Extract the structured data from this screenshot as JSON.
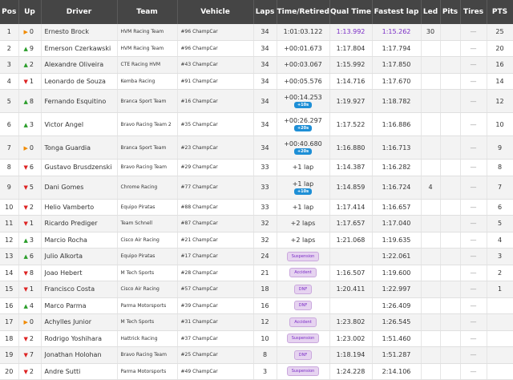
{
  "headers": {
    "pos": "Pos",
    "up": "Up",
    "driver": "Driver",
    "team": "Team",
    "vehicle": "Vehicle",
    "laps": "Laps",
    "time": "Time/Retired",
    "qual": "Qual Time",
    "fastest": "Fastest lap",
    "led": "Led",
    "pits": "Pits",
    "tires": "Tires",
    "pts": "PTS"
  },
  "colors": {
    "up": "#2a9d2a",
    "down": "#d22",
    "same": "#f08a00",
    "fastest": "#7a2cc6",
    "header_bg": "#454545"
  },
  "rows": [
    {
      "pos": "1",
      "dir": "same",
      "ch": "0",
      "driver": "Ernesto Brock",
      "team": "HVM Racing Team",
      "vehicle": "#96 ChampCar",
      "laps": "34",
      "time": "1:01:03.122",
      "pen": "",
      "qual": "1:13.992",
      "qual_best": true,
      "fastest": "1:15.262",
      "fastest_best": true,
      "led": "30",
      "pits": "",
      "tires": "—",
      "pts": "25"
    },
    {
      "pos": "2",
      "dir": "up",
      "ch": "9",
      "driver": "Emerson Czerkawski",
      "team": "HVM Racing Team",
      "vehicle": "#96 ChampCar",
      "laps": "34",
      "time": "+00:01.673",
      "pen": "",
      "qual": "1:17.804",
      "fastest": "1:17.794",
      "led": "",
      "pits": "",
      "tires": "—",
      "pts": "20"
    },
    {
      "pos": "3",
      "dir": "up",
      "ch": "2",
      "driver": "Alexandre Oliveira",
      "team": "CTE Racing HVM",
      "vehicle": "#43 ChampCar",
      "laps": "34",
      "time": "+00:03.067",
      "pen": "",
      "qual": "1:15.992",
      "fastest": "1:17.850",
      "led": "",
      "pits": "",
      "tires": "—",
      "pts": "16"
    },
    {
      "pos": "4",
      "dir": "down",
      "ch": "1",
      "driver": "Leonardo de Souza",
      "team": "Kemba Racing",
      "vehicle": "#91 ChampCar",
      "laps": "34",
      "time": "+00:05.576",
      "pen": "",
      "qual": "1:14.716",
      "fastest": "1:17.670",
      "led": "",
      "pits": "",
      "tires": "—",
      "pts": "14"
    },
    {
      "pos": "5",
      "dir": "up",
      "ch": "8",
      "driver": "Fernando Esquitino",
      "team": "Branca Sport Team",
      "vehicle": "#16 ChampCar",
      "laps": "34",
      "time": "+00:14.253",
      "pen": "+10s",
      "qual": "1:19.927",
      "fastest": "1:18.782",
      "led": "",
      "pits": "",
      "tires": "—",
      "pts": "12"
    },
    {
      "pos": "6",
      "dir": "up",
      "ch": "3",
      "driver": "Victor Angel",
      "team": "Bravo Racing Team 2",
      "vehicle": "#35 ChampCar",
      "laps": "34",
      "time": "+00:26.297",
      "pen": "+20s",
      "qual": "1:17.522",
      "fastest": "1:16.886",
      "led": "",
      "pits": "",
      "tires": "—",
      "pts": "10"
    },
    {
      "pos": "7",
      "dir": "same",
      "ch": "0",
      "driver": "Tonga Guardia",
      "team": "Branca Sport Team",
      "vehicle": "#23 ChampCar",
      "laps": "34",
      "time": "+00:40.680",
      "pen": "+20s",
      "qual": "1:16.880",
      "fastest": "1:16.713",
      "led": "",
      "pits": "",
      "tires": "—",
      "pts": "9"
    },
    {
      "pos": "8",
      "dir": "down",
      "ch": "6",
      "driver": "Gustavo Brusdzenski",
      "team": "Bravo Racing Team",
      "vehicle": "#29 ChampCar",
      "laps": "33",
      "time": "+1 lap",
      "pen": "",
      "qual": "1:14.387",
      "fastest": "1:16.282",
      "led": "",
      "pits": "",
      "tires": "—",
      "pts": "8"
    },
    {
      "pos": "9",
      "dir": "down",
      "ch": "5",
      "driver": "Dani Gomes",
      "team": "Chrome Racing",
      "vehicle": "#77 ChampCar",
      "laps": "33",
      "time": "+1 lap",
      "pen": "+10s",
      "qual": "1:14.859",
      "fastest": "1:16.724",
      "led": "4",
      "pits": "",
      "tires": "—",
      "pts": "7"
    },
    {
      "pos": "10",
      "dir": "down",
      "ch": "2",
      "driver": "Helio Vamberto",
      "team": "Equipo Piratas",
      "vehicle": "#88 ChampCar",
      "laps": "33",
      "time": "+1 lap",
      "pen": "",
      "qual": "1:17.414",
      "fastest": "1:16.657",
      "led": "",
      "pits": "",
      "tires": "—",
      "pts": "6"
    },
    {
      "pos": "11",
      "dir": "down",
      "ch": "1",
      "driver": "Ricardo Prediger",
      "team": "Team Schnell",
      "vehicle": "#87 ChampCar",
      "laps": "32",
      "time": "+2 laps",
      "pen": "",
      "qual": "1:17.657",
      "fastest": "1:17.040",
      "led": "",
      "pits": "",
      "tires": "—",
      "pts": "5"
    },
    {
      "pos": "12",
      "dir": "up",
      "ch": "3",
      "driver": "Marcio Rocha",
      "team": "Cisco Air Racing",
      "vehicle": "#21 ChampCar",
      "laps": "32",
      "time": "+2 laps",
      "pen": "",
      "qual": "1:21.068",
      "fastest": "1:19.635",
      "led": "",
      "pits": "",
      "tires": "—",
      "pts": "4"
    },
    {
      "pos": "13",
      "dir": "up",
      "ch": "6",
      "driver": "Julio Alkorta",
      "team": "Equipo Piratas",
      "vehicle": "#17 ChampCar",
      "laps": "24",
      "time": "",
      "badge": "Suspension",
      "pen": "",
      "qual": "",
      "fastest": "1:22.061",
      "led": "",
      "pits": "",
      "tires": "—",
      "pts": "3"
    },
    {
      "pos": "14",
      "dir": "down",
      "ch": "8",
      "driver": "Joao Hebert",
      "team": "M Tech Sports",
      "vehicle": "#28 ChampCar",
      "laps": "21",
      "time": "",
      "badge": "Accident",
      "pen": "",
      "qual": "1:16.507",
      "fastest": "1:19.600",
      "led": "",
      "pits": "",
      "tires": "—",
      "pts": "2"
    },
    {
      "pos": "15",
      "dir": "down",
      "ch": "1",
      "driver": "Francisco Costa",
      "team": "Cisco Air Racing",
      "vehicle": "#57 ChampCar",
      "laps": "18",
      "time": "",
      "badge": "DNF",
      "pen": "",
      "qual": "1:20.411",
      "fastest": "1:22.997",
      "led": "",
      "pits": "",
      "tires": "—",
      "pts": "1"
    },
    {
      "pos": "16",
      "dir": "up",
      "ch": "4",
      "driver": "Marco Parma",
      "team": "Parma Motorsports",
      "vehicle": "#39 ChampCar",
      "laps": "16",
      "time": "",
      "badge": "DNF",
      "pen": "",
      "qual": "",
      "fastest": "1:26.409",
      "led": "",
      "pits": "",
      "tires": "—",
      "pts": ""
    },
    {
      "pos": "17",
      "dir": "same",
      "ch": "0",
      "driver": "Achylles Junior",
      "team": "M Tech Sports",
      "vehicle": "#31 ChampCar",
      "laps": "12",
      "time": "",
      "badge": "Accident",
      "pen": "",
      "qual": "1:23.802",
      "fastest": "1:26.545",
      "led": "",
      "pits": "",
      "tires": "—",
      "pts": ""
    },
    {
      "pos": "18",
      "dir": "down",
      "ch": "2",
      "driver": "Rodrigo Yoshihara",
      "team": "Hattrick Racing",
      "vehicle": "#37 ChampCar",
      "laps": "10",
      "time": "",
      "badge": "Suspension",
      "pen": "",
      "qual": "1:23.002",
      "fastest": "1:51.460",
      "led": "",
      "pits": "",
      "tires": "—",
      "pts": ""
    },
    {
      "pos": "19",
      "dir": "down",
      "ch": "7",
      "driver": "Jonathan Holohan",
      "team": "Bravo Racing Team",
      "vehicle": "#25 ChampCar",
      "laps": "8",
      "time": "",
      "badge": "DNF",
      "pen": "",
      "qual": "1:18.194",
      "fastest": "1:51.287",
      "led": "",
      "pits": "",
      "tires": "—",
      "pts": ""
    },
    {
      "pos": "20",
      "dir": "down",
      "ch": "2",
      "driver": "Andre Sutti",
      "team": "Parma Motorsports",
      "vehicle": "#49 ChampCar",
      "laps": "3",
      "time": "",
      "badge": "Suspension",
      "pen": "",
      "qual": "1:24.228",
      "fastest": "2:14.106",
      "led": "",
      "pits": "",
      "tires": "—",
      "pts": ""
    }
  ]
}
